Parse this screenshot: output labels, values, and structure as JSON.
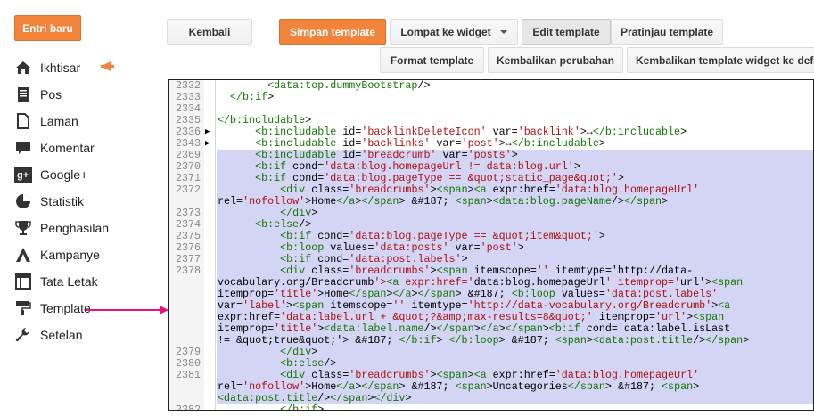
{
  "sidebar": {
    "new_post": "Entri baru",
    "items": [
      {
        "label": "Ikhtisar",
        "icon": "home-icon"
      },
      {
        "label": "Pos",
        "icon": "posts-icon"
      },
      {
        "label": "Laman",
        "icon": "pages-icon"
      },
      {
        "label": "Komentar",
        "icon": "comment-icon"
      },
      {
        "label": "Google+",
        "icon": "google-plus-icon"
      },
      {
        "label": "Statistik",
        "icon": "stats-icon"
      },
      {
        "label": "Penghasilan",
        "icon": "trophy-icon"
      },
      {
        "label": "Kampanye",
        "icon": "campaign-icon"
      },
      {
        "label": "Tata Letak",
        "icon": "layout-icon"
      },
      {
        "label": "Template",
        "icon": "paint-roller-icon"
      },
      {
        "label": "Setelan",
        "icon": "wrench-icon"
      }
    ]
  },
  "toolbar": {
    "back": "Kembali",
    "save": "Simpan template",
    "jump": "Lompat ke widget",
    "edit": "Edit template",
    "preview": "Pratinjau template",
    "format": "Format template",
    "revert": "Kembalikan perubahan",
    "revert_widget": "Kembalikan template widget ke defa"
  },
  "colors": {
    "accent": "#f2833b",
    "arrow": "#e8137a",
    "selection": "#d4d4f4"
  },
  "editor": {
    "lines": [
      {
        "num": "2332",
        "text": "        <data:top.dummyBootstrap/>",
        "fold": "",
        "sel": false
      },
      {
        "num": "2333",
        "text": "  </b:if>",
        "fold": "",
        "sel": false
      },
      {
        "num": "2334",
        "text": "",
        "fold": "",
        "sel": false
      },
      {
        "num": "2335",
        "text": "</b:includable>",
        "fold": "",
        "sel": false
      },
      {
        "num": "2336",
        "text": "      <b:includable id='backlinkDeleteIcon' var='backlink'>↔</b:includable>",
        "fold": "▶",
        "sel": false
      },
      {
        "num": "2343",
        "text": "      <b:includable id='backlinks' var='post'>↔</b:includable>",
        "fold": "▶",
        "sel": false
      },
      {
        "num": "2369",
        "text": "      <b:includable id='breadcrumb' var='posts'>",
        "fold": "",
        "sel": true
      },
      {
        "num": "2370",
        "text": "      <b:if cond='data:blog.homepageUrl != data:blog.url'>",
        "fold": "",
        "sel": true
      },
      {
        "num": "2371",
        "text": "      <b:if cond='data:blog.pageType == &quot;static_page&quot;'>",
        "fold": "",
        "sel": true
      },
      {
        "num": "2372",
        "text": "          <div class='breadcrumbs'><span><a expr:href='data:blog.homepageUrl'",
        "fold": "",
        "sel": true
      },
      {
        "num": "",
        "text": "rel='nofollow'>Home</a></span> &#187; <span><data:blog.pageName/></span>",
        "fold": "",
        "sel": true
      },
      {
        "num": "2373",
        "text": "          </div>",
        "fold": "",
        "sel": true
      },
      {
        "num": "2374",
        "text": "      <b:else/>",
        "fold": "",
        "sel": true
      },
      {
        "num": "2375",
        "text": "          <b:if cond='data:blog.pageType == &quot;item&quot;'>",
        "fold": "",
        "sel": true
      },
      {
        "num": "2376",
        "text": "          <b:loop values='data:posts' var='post'>",
        "fold": "",
        "sel": true
      },
      {
        "num": "2377",
        "text": "          <b:if cond='data:post.labels'>",
        "fold": "",
        "sel": true
      },
      {
        "num": "2378",
        "text": "          <div class='breadcrumbs'><span itemscope='' itemtype='http://data-",
        "fold": "",
        "sel": true
      },
      {
        "num": "",
        "text": "vocabulary.org/Breadcrumb'><a expr:href='data:blog.homepageUrl' itemprop='url'><span",
        "fold": "",
        "sel": true
      },
      {
        "num": "",
        "text": "itemprop='title'>Home</span></a></span> &#187; <b:loop values='data:post.labels'",
        "fold": "",
        "sel": true
      },
      {
        "num": "",
        "text": "var='label'><span itemscope='' itemtype='http://data-vocabulary.org/Breadcrumb'><a",
        "fold": "",
        "sel": true
      },
      {
        "num": "",
        "text": "expr:href='data:label.url + &quot;?&amp;max-results=8&quot;' itemprop='url'><span",
        "fold": "",
        "sel": true
      },
      {
        "num": "",
        "text": "itemprop='title'><data:label.name/></span></a></span><b:if cond='data:label.isLast",
        "fold": "",
        "sel": true
      },
      {
        "num": "",
        "text": "!= &quot;true&quot;'> &#187; </b:if> </b:loop> &#187; <span><data:post.title/></span>",
        "fold": "",
        "sel": true
      },
      {
        "num": "2379",
        "text": "          </div>",
        "fold": "",
        "sel": true
      },
      {
        "num": "2380",
        "text": "          <b:else/>",
        "fold": "",
        "sel": true
      },
      {
        "num": "2381",
        "text": "          <div class='breadcrumbs'><span><a expr:href='data:blog.homepageUrl'",
        "fold": "",
        "sel": true
      },
      {
        "num": "",
        "text": "rel='nofollow'>Home</a></span> &#187; <span>Uncategories</span> &#187; <span>",
        "fold": "",
        "sel": true
      },
      {
        "num": "",
        "text": "<data:post.title/></span></div>",
        "fold": "",
        "sel": true
      },
      {
        "num": "2382",
        "text": "          </b:if>",
        "fold": "",
        "sel": false
      }
    ]
  }
}
